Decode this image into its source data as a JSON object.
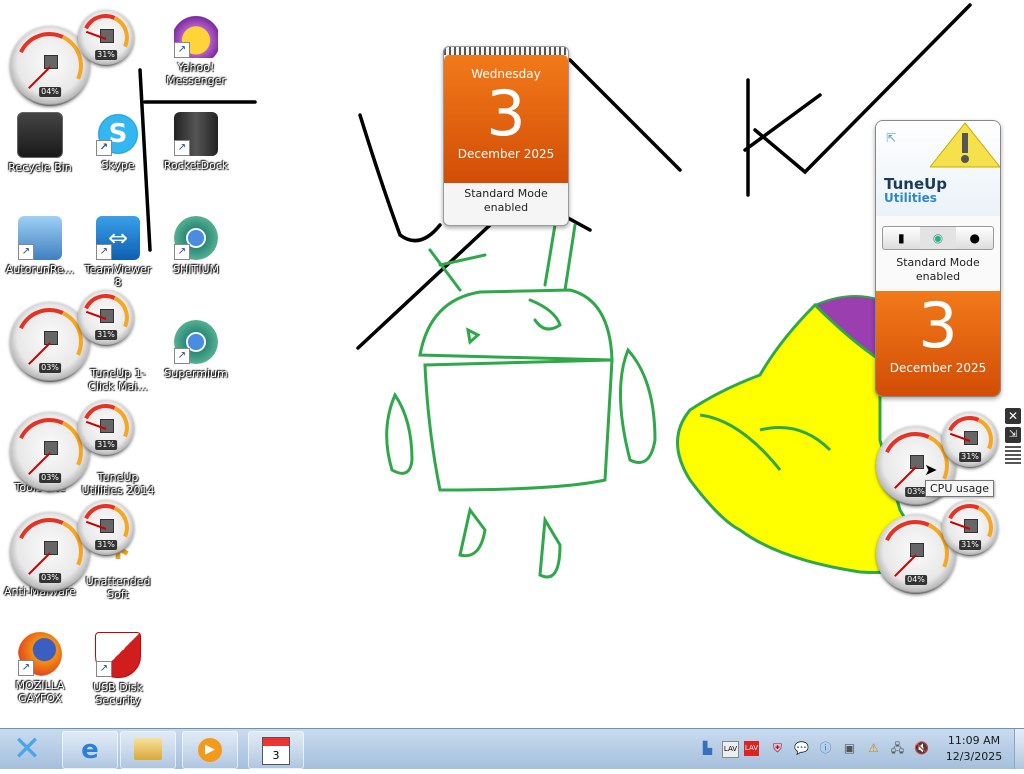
{
  "desktop_icons": [
    {
      "label": "Yahoo! Messenger",
      "icon": "yahoo-messenger-icon"
    },
    {
      "label": "Recycle Bin",
      "icon": "recycle-bin-icon"
    },
    {
      "label": "Skype",
      "icon": "skype-icon"
    },
    {
      "label": "RocketDock",
      "icon": "rocketdock-icon"
    },
    {
      "label": "AutorunRe...",
      "icon": "autorun-icon"
    },
    {
      "label": "TeamViewer 8",
      "icon": "teamviewer-icon"
    },
    {
      "label": "SHITIUM",
      "icon": "chromium-icon"
    },
    {
      "label": "TuneUp 1-Click Mai...",
      "icon": "tuneup-icon"
    },
    {
      "label": "Supermium",
      "icon": "supermium-icon"
    },
    {
      "label": "TuneUp Utilities 2014",
      "icon": "tuneup-icon"
    },
    {
      "label": "Unattended Soft",
      "icon": "unattended-icon"
    },
    {
      "label": "Anti-Malware",
      "icon": "malwarebytes-icon"
    },
    {
      "label": "MOZILLA GAYFOX",
      "icon": "firefox-icon"
    },
    {
      "label": "USB Disk Security",
      "icon": "usb-security-icon"
    },
    {
      "label": "Tools Lite",
      "icon": "tools-lite-icon"
    }
  ],
  "gadget_gauges": [
    {
      "cpu": "04%",
      "ram": "31%"
    },
    {
      "cpu": "03%",
      "ram": "31%"
    },
    {
      "cpu": "03%",
      "ram": "31%"
    },
    {
      "cpu": "03%",
      "ram": "31%"
    },
    {
      "cpu": "03%",
      "ram": "31%"
    },
    {
      "cpu": "04%",
      "ram": "31%"
    }
  ],
  "calendar_gadget": {
    "weekday": "Wednesday",
    "day": "3",
    "month_year": "December 2025",
    "footer": "Standard Mode enabled"
  },
  "tuneup_gadget": {
    "brand_line1": "TuneUp",
    "brand_line2": "Utilities",
    "mode_text": "Standard Mode enabled",
    "day": "3",
    "month_year": "December 2025"
  },
  "tooltip": {
    "text": "CPU usage"
  },
  "taskbar": {
    "time": "11:09 AM",
    "date": "12/3/2025",
    "pinned": [
      "start-orb-icon",
      "internet-explorer-icon",
      "windows-explorer-icon",
      "media-player-icon",
      "calendar-app-icon"
    ]
  },
  "colors": {
    "drawing_green": "#2fa84a",
    "drawing_yellow": "#ffff00",
    "drawing_purple": "#9b3fb0",
    "calendar_orange": "#e05a0c"
  }
}
